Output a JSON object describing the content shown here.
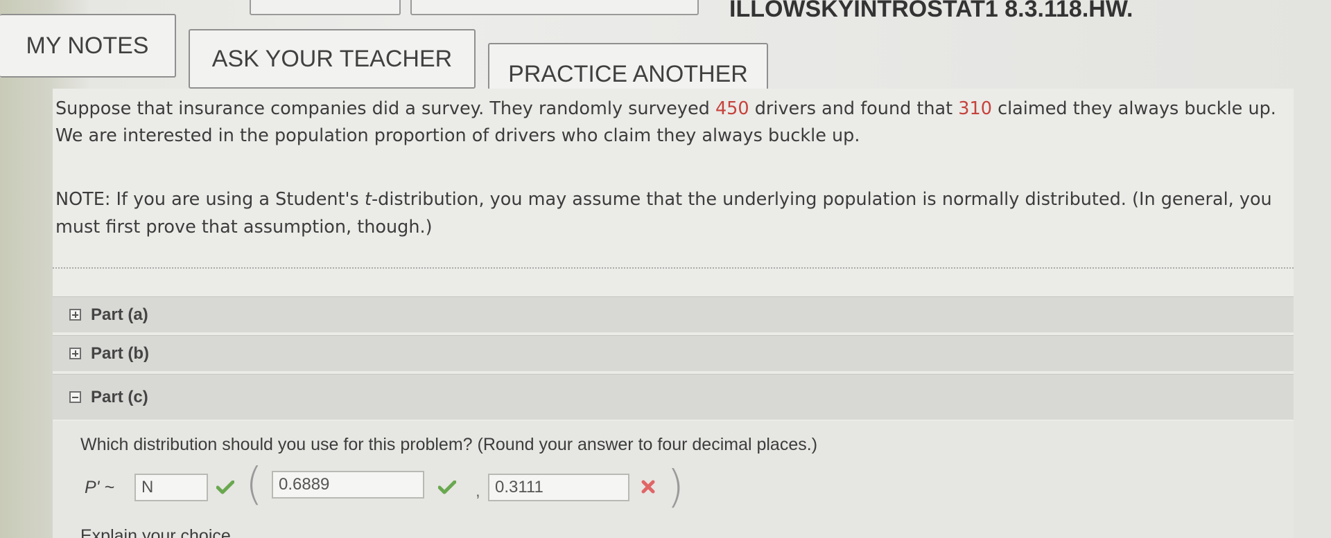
{
  "header": {
    "assignment_code": "ILLOWSKYINTROSTAT1 8.3.118.HW."
  },
  "toolbar": {
    "my_notes": "MY NOTES",
    "ask_teacher": "ASK YOUR TEACHER",
    "practice_another": "PRACTICE ANOTHER"
  },
  "question": {
    "stem_1": "Suppose that insurance companies did a survey. They randomly surveyed ",
    "sample_size": "450",
    "stem_2": " drivers and found that ",
    "successes": "310",
    "stem_3": " claimed they always buckle up. We are interested in the population proportion of drivers who claim they always buckle up.",
    "note_1": "NOTE: If you are using a Student's ",
    "note_t": "t",
    "note_2": "-distribution, you may assume that the underlying population is normally distributed. (In general, you must first prove that assumption, though.)"
  },
  "parts": [
    {
      "label": "Part (a)",
      "state": "collapsed"
    },
    {
      "label": "Part (b)",
      "state": "collapsed"
    },
    {
      "label": "Part (c)",
      "state": "expanded"
    }
  ],
  "part_c": {
    "prompt": "Which distribution should you use for this problem? (Round your answer to four decimal places.)",
    "variable": "P' ~",
    "distribution_value": "N",
    "mean_value": "0.6889",
    "sd_value": "0.3111",
    "explain_label": "Explain your choice.",
    "colors": {
      "correct": "#6aa84f",
      "incorrect": "#e06666"
    }
  }
}
